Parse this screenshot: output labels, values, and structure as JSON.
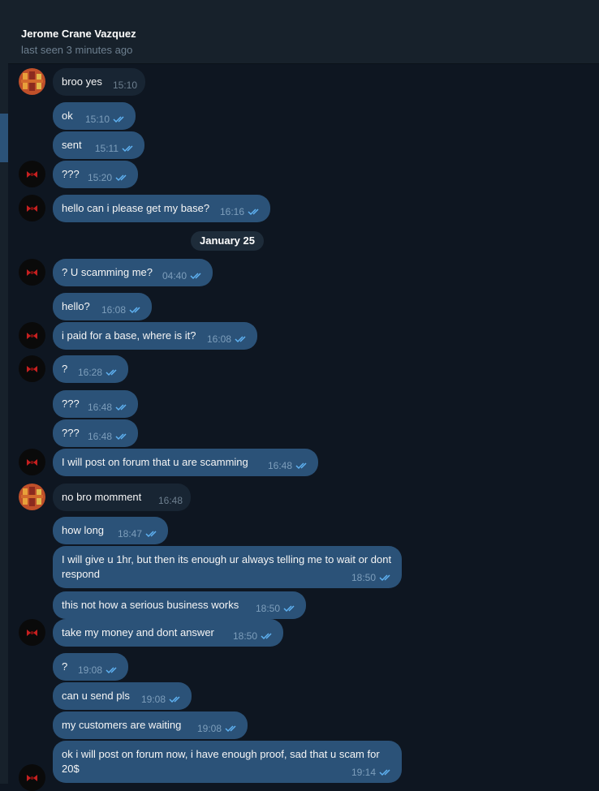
{
  "chat": {
    "contact_name": "Jerome Crane Vazquez",
    "status": "last seen 3 minutes ago"
  },
  "date_separator": "January 25",
  "messages": [
    {
      "text": "broo yes",
      "time": "15:10",
      "dir": "in"
    },
    {
      "text": "ok",
      "time": "15:10",
      "dir": "out"
    },
    {
      "text": "sent",
      "time": "15:11",
      "dir": "out"
    },
    {
      "text": "???",
      "time": "15:20",
      "dir": "out"
    },
    {
      "text": "hello can i please get my base?",
      "time": "16:16",
      "dir": "out"
    },
    {
      "text": "? U scamming me?",
      "time": "04:40",
      "dir": "out"
    },
    {
      "text": "hello?",
      "time": "16:08",
      "dir": "out"
    },
    {
      "text": "i paid for a base, where is it?",
      "time": "16:08",
      "dir": "out"
    },
    {
      "text": "?",
      "time": "16:28",
      "dir": "out"
    },
    {
      "text": "???",
      "time": "16:48",
      "dir": "out"
    },
    {
      "text": "???",
      "time": "16:48",
      "dir": "out"
    },
    {
      "text": "I will post on forum that u are scamming",
      "time": "16:48",
      "dir": "out"
    },
    {
      "text": "no bro momment",
      "time": "16:48",
      "dir": "in"
    },
    {
      "text": "how long",
      "time": "18:47",
      "dir": "out"
    },
    {
      "text": "I will give u 1hr, but then its enough ur always telling me to wait or dont respond",
      "time": "18:50",
      "dir": "out"
    },
    {
      "text": "this not how a serious business works",
      "time": "18:50",
      "dir": "out"
    },
    {
      "text": "take my money and dont answer",
      "time": "18:50",
      "dir": "out"
    },
    {
      "text": "?",
      "time": "19:08",
      "dir": "out"
    },
    {
      "text": "can u send pls",
      "time": "19:08",
      "dir": "out"
    },
    {
      "text": "my customers are waiting",
      "time": "19:08",
      "dir": "out"
    },
    {
      "text": "ok i will post on forum now, i have enough proof, sad that u scam for 20$",
      "time": "19:14",
      "dir": "out"
    }
  ],
  "colors": {
    "background": "#0e1621",
    "outgoing_bubble": "#2b5278",
    "incoming_bubble": "#182533",
    "read_checks": "#5fb2f2"
  }
}
